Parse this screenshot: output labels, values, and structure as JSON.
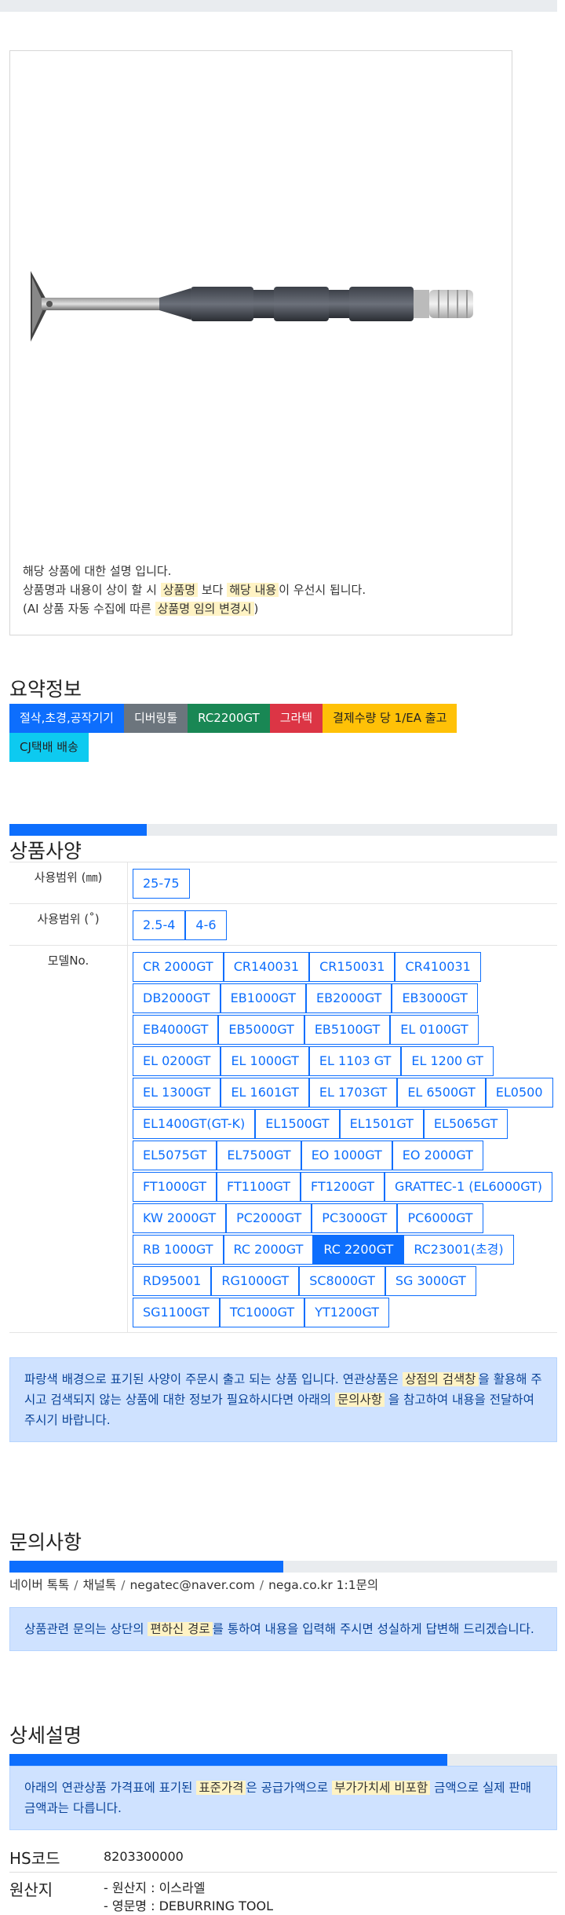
{
  "description": {
    "line1": "해당 상품에 대한 설명 입니다.",
    "line2_pre": "상품명과 내용이 상이 할 시",
    "line2_hl1": "상품명",
    "line2_mid": "보다",
    "line2_hl2": "해당 내용",
    "line2_post": "이 우선시 됩니다.",
    "line3_pre": "(AI 상품 자동 수집에 따른",
    "line3_hl": "상품명 임의 변경시",
    "line3_post": ")"
  },
  "summary": {
    "title": "요약정보",
    "badges": [
      {
        "label": "절삭,초경,공작기기",
        "color": "#0d6efd"
      },
      {
        "label": "디버링툴",
        "color": "#6c757d"
      },
      {
        "label": "RC2200GT",
        "color": "#198754"
      },
      {
        "label": "그라텍",
        "color": "#dc3545"
      },
      {
        "label": "결제수량 당 1/EA 출고",
        "color": "#ffc107"
      },
      {
        "label": "CJ택배 배송",
        "color": "#0dcaf0"
      }
    ]
  },
  "specs": {
    "title": "상품사양",
    "progress": 0.25,
    "rows": [
      {
        "label": "사용범위 (㎜)",
        "values": [
          "25-75"
        ]
      },
      {
        "label": "사용범위 (˚)",
        "values": [
          "2.5-4",
          "4-6"
        ]
      },
      {
        "label": "모델No.",
        "values": [
          "CR 2000GT",
          "CR140031",
          "CR150031",
          "CR410031",
          "DB2000GT",
          "EB1000GT",
          "EB2000GT",
          "EB3000GT",
          "EB4000GT",
          "EB5000GT",
          "EB5100GT",
          "EL 0100GT",
          "EL 0200GT",
          "EL 1000GT",
          "EL 1103 GT",
          "EL 1200 GT",
          "EL 1300GT",
          "EL 1601GT",
          "EL 1703GT",
          "EL 6500GT",
          "EL0500",
          "EL1400GT(GT-K)",
          "EL1500GT",
          "EL1501GT",
          "EL5065GT",
          "EL5075GT",
          "EL7500GT",
          "EO 1000GT",
          "EO 2000GT",
          "FT1000GT",
          "FT1100GT",
          "FT1200GT",
          "GRATTEC-1 (EL6000GT)",
          "KW 2000GT",
          "PC2000GT",
          "PC3000GT",
          "PC6000GT",
          "RB 1000GT",
          "RC 2000GT",
          "RC 2200GT",
          "RC23001(초경)",
          "RD95001",
          "RG1000GT",
          "SC8000GT",
          "SG 3000GT",
          "SG1100GT",
          "TC1000GT",
          "YT1200GT"
        ],
        "active": "RC 2200GT"
      }
    ],
    "notice_pre": "파랑색 배경으로 표기된 사양이 주문시 출고 되는 상품 입니다. 연관상품은",
    "notice_hl1": "상점의 검색창",
    "notice_mid": "을 활용해 주시고 검색되지 않는 상품에 대한 정보가 필요하시다면 아래의",
    "notice_hl2": "문의사항",
    "notice_post": "을 참고하여 내용을 전달하여 주시기 바랍니다."
  },
  "inquiry": {
    "title": "문의사항",
    "progress": 0.5,
    "channels": [
      "네이버 톡톡",
      "채널톡",
      "negatec@naver.com",
      "nega.co.kr 1:1문의"
    ],
    "notice_pre": "상품관련 문의는 상단의",
    "notice_hl": "편하신 경로",
    "notice_post": "를 통하여 내용을 입력해 주시면 성실하게 답변해 드리겠습니다."
  },
  "detail": {
    "title": "상세설명",
    "progress": 0.8,
    "notice_pre": "아래의 연관상품 가격표에 표기된",
    "notice_hl1": "표준가격",
    "notice_mid": "은 공급가액으로",
    "notice_hl2": "부가가치세 비포함",
    "notice_post": "금액으로 실제 판매금액과는 다릅니다.",
    "hs_label": "HS코드",
    "hs_value": "8203300000",
    "origin_label": "원산지",
    "origin_line1": "- 원산지 : 이스라엘",
    "origin_line2": "- 영문명 : DEBURRING TOOL"
  }
}
